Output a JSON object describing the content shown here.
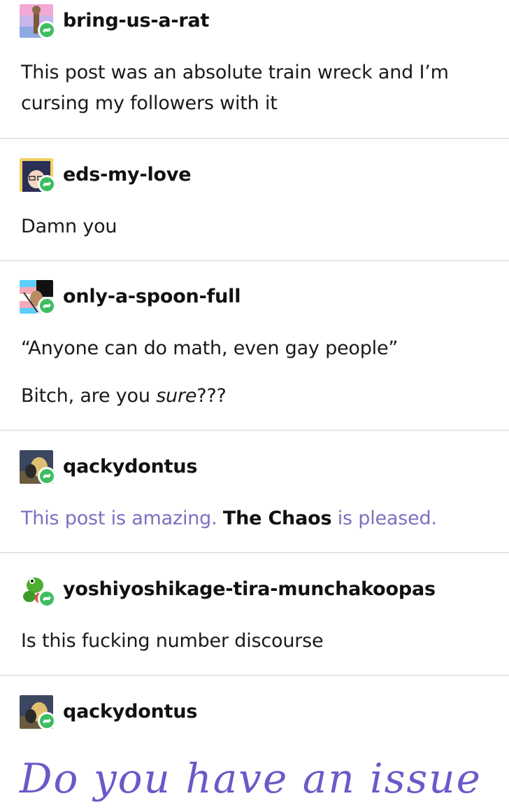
{
  "posts": [
    {
      "username": "bring-us-a-rat",
      "avatar_icon": "rat-figure-avatar-icon",
      "lines": [
        "This post was an absolute train wreck and I’m",
        "cursing my followers with it"
      ]
    },
    {
      "username": "eds-my-love",
      "avatar_icon": "anime-character-avatar-icon",
      "lines": [
        "Damn you"
      ]
    },
    {
      "username": "only-a-spoon-full",
      "avatar_icon": "doll-flag-avatar-icon",
      "lines": [
        "“Anyone can do math, even gay people”"
      ],
      "line2_prefix": "Bitch, are you ",
      "line2_italic": "sure",
      "line2_suffix": "???"
    },
    {
      "username": "qackydontus",
      "avatar_icon": "duck-creature-avatar-icon",
      "seg1": "This post is amazing. ",
      "seg2": "The Chaos",
      "seg3": " is pleased."
    },
    {
      "username": "yoshiyoshikage-tira-munchakoopas",
      "avatar_icon": "yoshi-avatar-icon",
      "lines": [
        "Is this fucking number discourse"
      ]
    },
    {
      "username": "qackydontus",
      "avatar_icon": "duck-creature-avatar-icon",
      "script_text": "Do you have an issue"
    }
  ],
  "colors": {
    "reblog_green": "#3dbe61",
    "purple_text": "#7c70c0",
    "script_purple": "#6e58c8",
    "divider": "#d4d4d4"
  }
}
